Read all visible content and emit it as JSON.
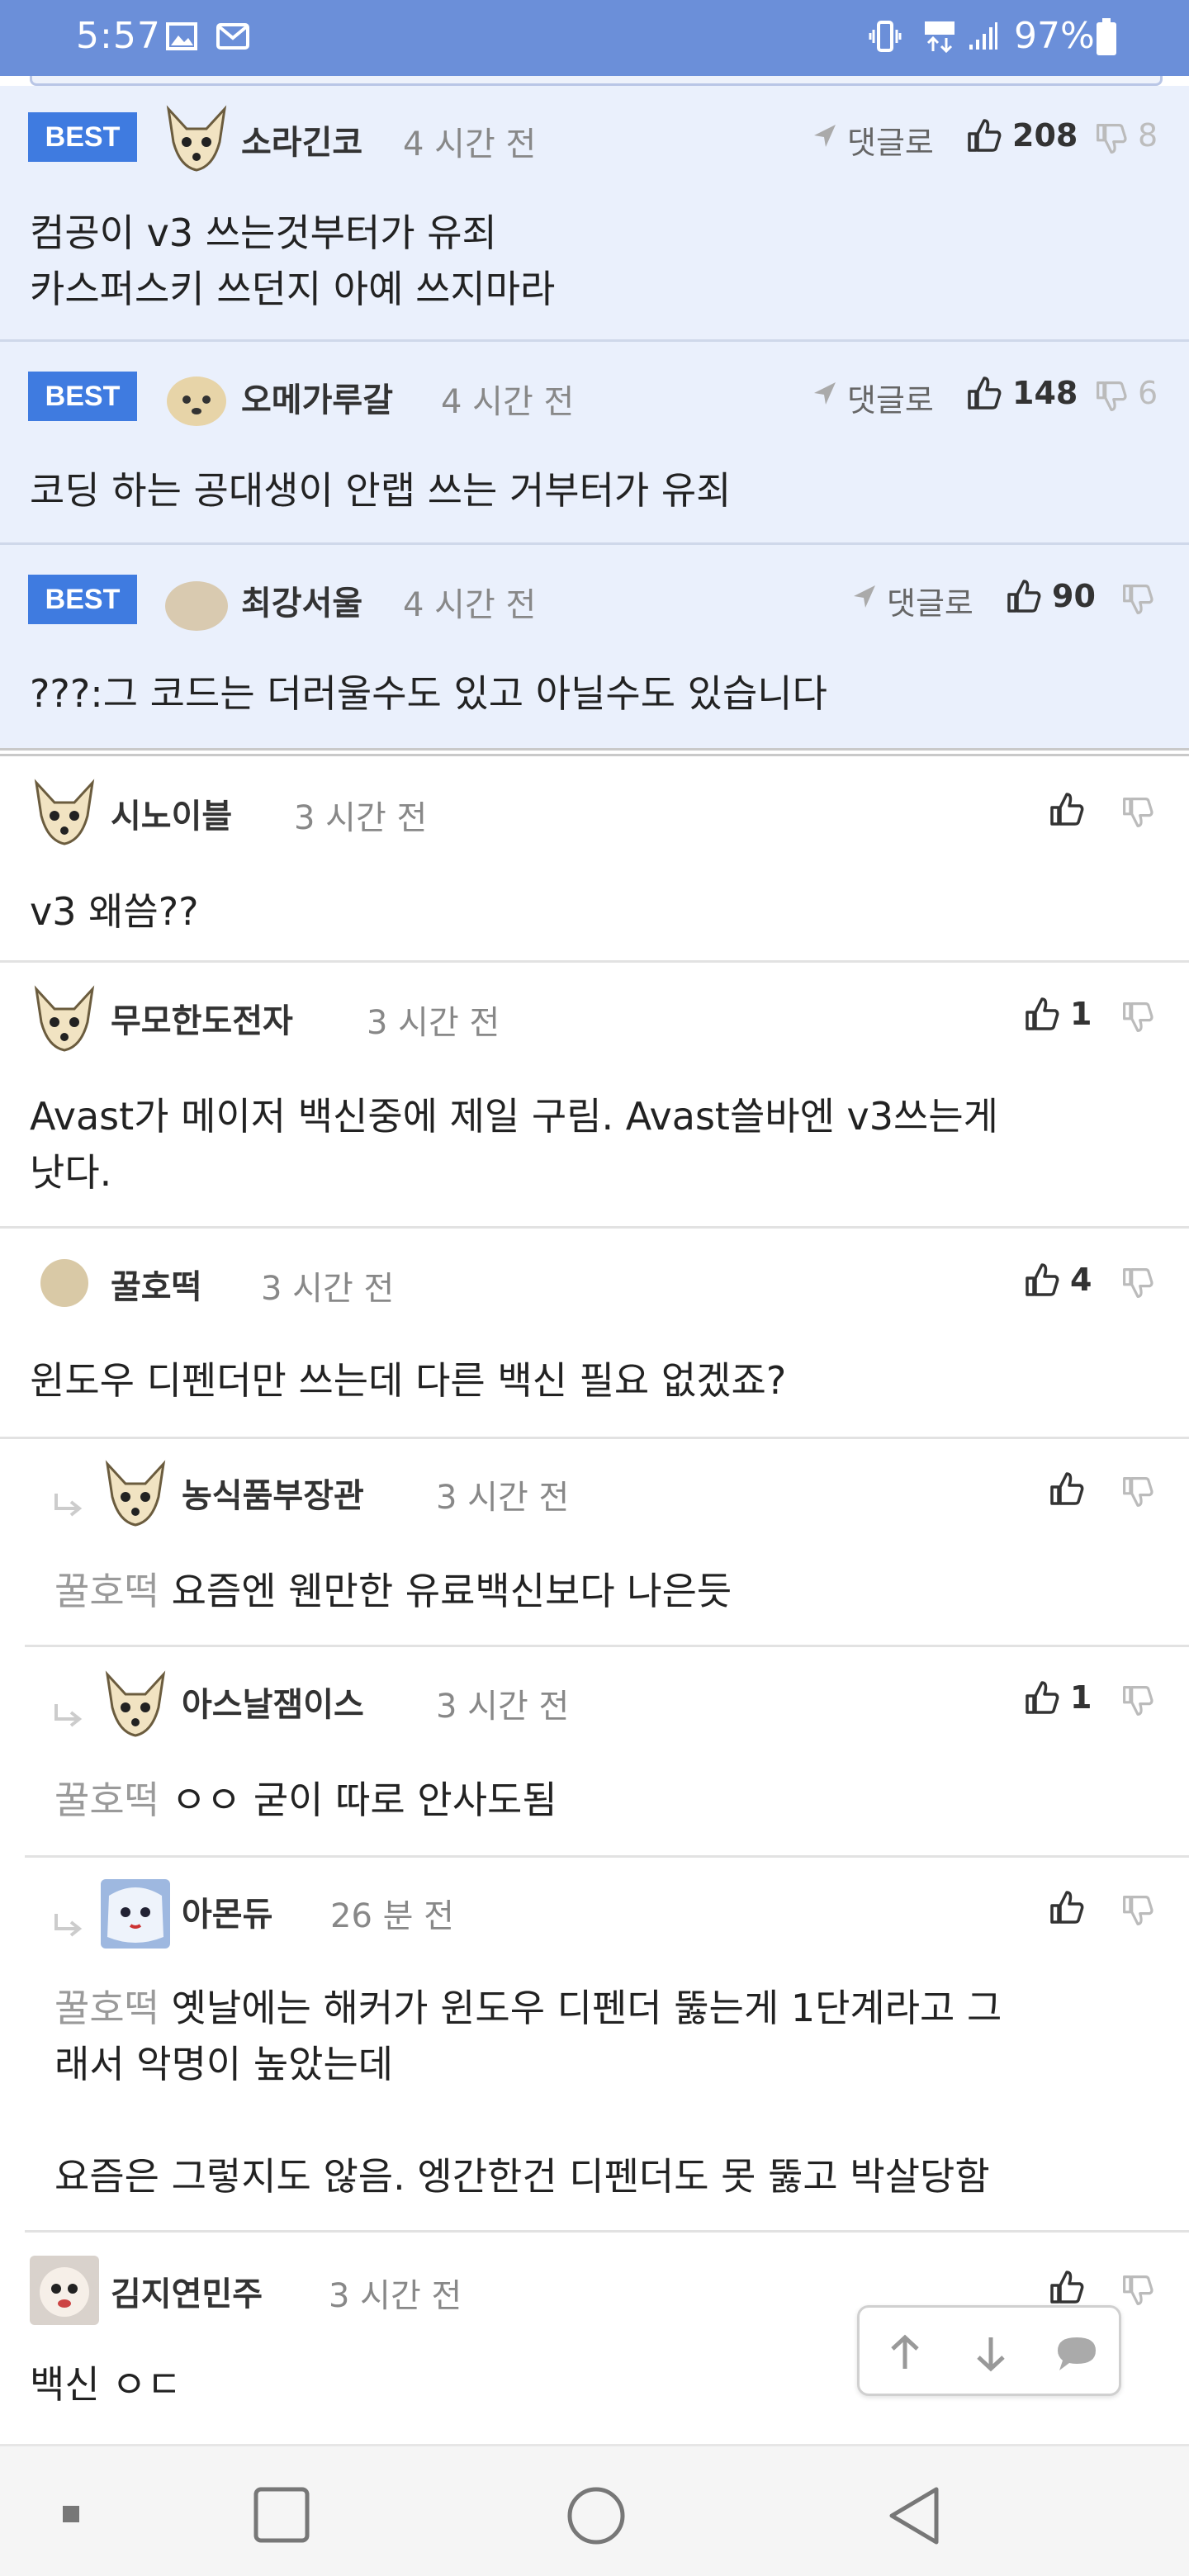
{
  "status_bar": {
    "time": "5:57",
    "battery": "97%",
    "icons": [
      "image-icon",
      "mail-icon",
      "vibrate-icon",
      "lte-icon",
      "signal-icon",
      "battery-icon"
    ]
  },
  "best_label": "BEST",
  "reply_label": "댓글로",
  "best_comments": [
    {
      "nick": "소라긴코",
      "time": "4 시간 전",
      "likes": "208",
      "dislikes": "8",
      "text": "컴공이 v3 쓰는것부터가 유죄\n카스퍼스키 쓰던지 아예 쓰지마라"
    },
    {
      "nick": "오메가루갈",
      "time": "4 시간 전",
      "likes": "148",
      "dislikes": "6",
      "text": "코딩 하는 공대생이 안랩 쓰는 거부터가 유죄"
    },
    {
      "nick": "최강서울",
      "time": "4 시간 전",
      "likes": "90",
      "dislikes": "",
      "text": "???:그 코드는 더러울수도 있고 아닐수도 있습니다"
    }
  ],
  "comments": [
    {
      "nick": "시노이블",
      "time": "3 시간 전",
      "likes": "",
      "text": "v3 왜씀??"
    },
    {
      "nick": "무모한도전자",
      "time": "3 시간 전",
      "likes": "1",
      "text": "Avast가 메이저 백신중에 제일 구림. Avast쓸바엔 v3쓰는게\n낫다."
    },
    {
      "nick": "꿀호떡",
      "time": "3 시간 전",
      "likes": "4",
      "text": "윈도우 디펜더만 쓰는데 다른 백신 필요 없겠죠?"
    }
  ],
  "replies": [
    {
      "nick": "농식품부장관",
      "time": "3 시간 전",
      "likes": "",
      "mention": "꿀호떡",
      "text": " 요즘엔 웬만한 유료백신보다 나은듯"
    },
    {
      "nick": "아스날잼이스",
      "time": "3 시간 전",
      "likes": "1",
      "mention": "꿀호떡",
      "text": " ㅇㅇ 굳이 따로 안사도됨"
    },
    {
      "nick": "아몬듀",
      "time": "26 분 전",
      "likes": "",
      "mention": "꿀호떡",
      "text": " 옛날에는 해커가 윈도우 디펜더 뚫는게 1단계라고 그\n래서 악명이 높았는데\n\n요즘은 그렇지도 않음. 엥간한건 디펜더도 못 뚫고 박살당함"
    }
  ],
  "last_comment": {
    "nick": "김지연민주",
    "time": "3 시간 전",
    "text": "백신 ㅇㄷ"
  },
  "colors": {
    "status_bar": "#6b8fd9",
    "best_bg": "#eaf0fc",
    "badge": "#3f7be0"
  }
}
